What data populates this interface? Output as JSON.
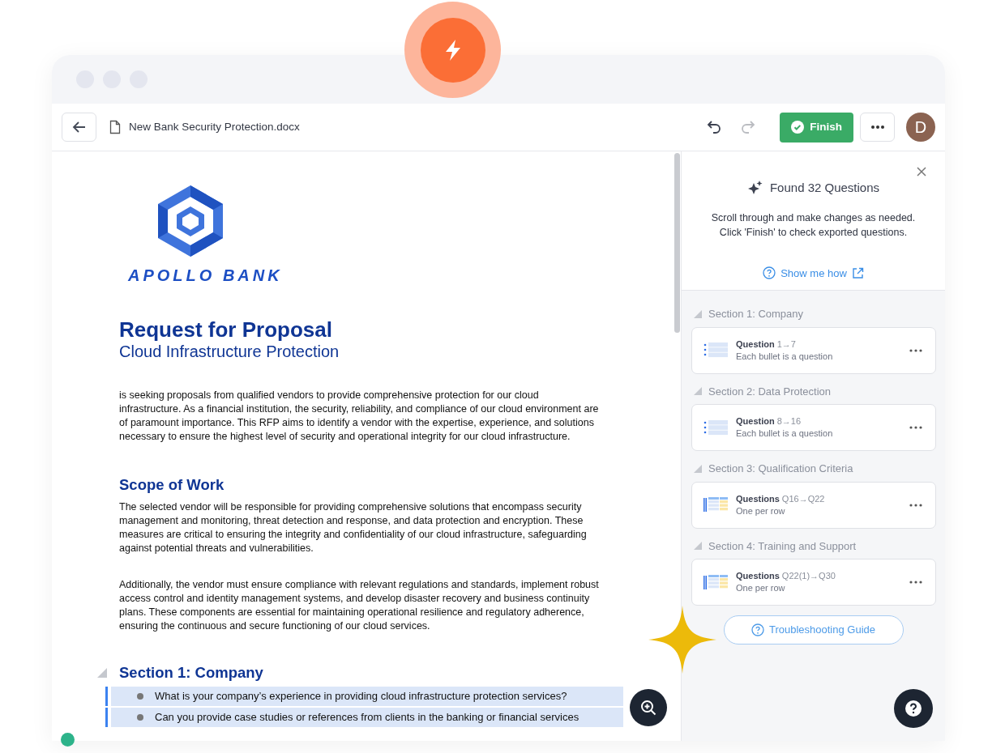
{
  "toolbar": {
    "file_name": "New Bank Security Protection.docx",
    "history": [
      {
        "kind": "undo",
        "disabled": false
      },
      {
        "kind": "redo",
        "disabled": true
      }
    ],
    "finish": "Finish",
    "avatar": "D"
  },
  "document": {
    "logo_text": "APOLLO BANK",
    "title": "Request for Proposal",
    "subtitle": "Cloud Infrastructure Protection",
    "intro": "is seeking proposals from qualified vendors to provide comprehensive protection for our cloud infrastructure. As a financial institution, the security, reliability, and compliance of our cloud environment are of paramount importance. This RFP aims to identify a vendor with the expertise, experience, and solutions necessary to ensure the highest level of security and operational integrity for our cloud infrastructure.",
    "scope_heading": "Scope of Work",
    "paragraphs": [
      "The selected vendor will be responsible for providing comprehensive solutions that encompass security management and monitoring, threat detection and response, and data protection and encryption. These measures are critical to ensuring the integrity and confidentiality of our cloud infrastructure, safeguarding against potential threats and vulnerabilities.",
      "Additionally, the vendor must ensure compliance with relevant regulations and standards, implement robust access control and identity management systems, and develop disaster recovery and business continuity plans. These components are essential for maintaining operational resilience and regulatory adherence, ensuring the continuous and secure functioning of our cloud services."
    ],
    "section": {
      "title": "Section 1: Company",
      "expanded": true,
      "questions": [
        {
          "text": "What is your company’s experience in providing cloud infrastructure protection services?",
          "highlighted": true
        },
        {
          "text": "Can you provide case studies or references from clients in the banking or financial services",
          "highlighted": true
        }
      ]
    }
  },
  "panel": {
    "title": "Found 32 Questions",
    "description": [
      "Scroll through and make changes as needed.",
      "Click 'Finish' to check exported questions."
    ],
    "link": "Show me how",
    "sections": [
      {
        "title": "Section 1: Company",
        "expanded": true,
        "kind": "bullets",
        "label": "Question",
        "range": "1→7",
        "note": "Each bullet is a question"
      },
      {
        "title": "Section 2: Data Protection",
        "expanded": true,
        "kind": "bullets",
        "label": "Question",
        "range": "8→16",
        "note": "Each bullet is a question"
      },
      {
        "title": "Section 3: Qualification Criteria",
        "expanded": true,
        "kind": "table",
        "label": "Questions",
        "range": "Q16→Q22",
        "note": "One per row"
      },
      {
        "title": "Section 4: Training and Support",
        "expanded": true,
        "kind": "table",
        "label": "Questions",
        "range": "Q22(1)→Q30",
        "note": "One per row"
      }
    ],
    "guide": "Troubleshooting Guide"
  }
}
